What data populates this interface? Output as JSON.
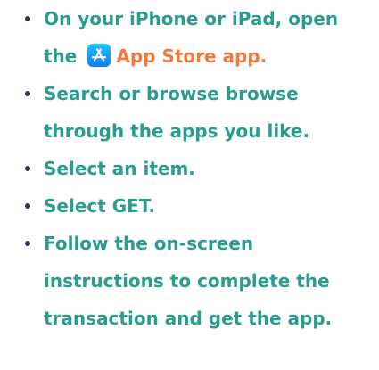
{
  "colors": {
    "text": "#2a9d8f",
    "accent": "#f07b3c",
    "bullet": "#2b3a52",
    "icon_top": "#1ec3ff",
    "icon_bottom": "#0a7cf2"
  },
  "steps": [
    {
      "line1": "On your iPhone or iPad, open",
      "line2_prefix": "the",
      "icon": "app-store-icon",
      "app_name": "App Store app."
    },
    {
      "line1": "Search or browse browse",
      "line2": "through the apps you like."
    },
    {
      "line1": "Select an item."
    },
    {
      "line1": "Select GET."
    },
    {
      "line1": "Follow the on-screen",
      "line2": "instructions to complete the",
      "line3": "transaction and get the app."
    }
  ]
}
